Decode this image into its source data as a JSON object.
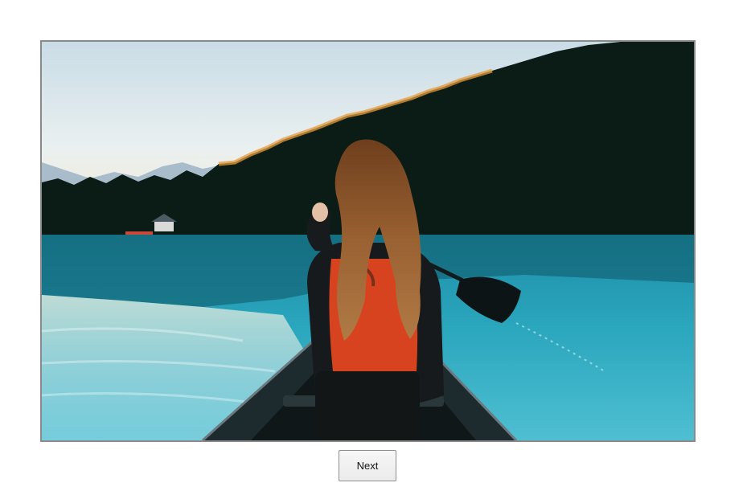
{
  "photo": {
    "subject": "woman-in-canoe-on-lake",
    "colors": {
      "sky_top": "#dbe7ee",
      "sky_glow": "#f4e6c8",
      "forest": "#0b1c16",
      "water": "#2aa6bd",
      "water_light": "#9dd5df",
      "life_vest": "#d8431f",
      "hair": "#8a5528",
      "canoe": "#1d2a2e"
    }
  },
  "navigation": {
    "next_label": "Next"
  }
}
